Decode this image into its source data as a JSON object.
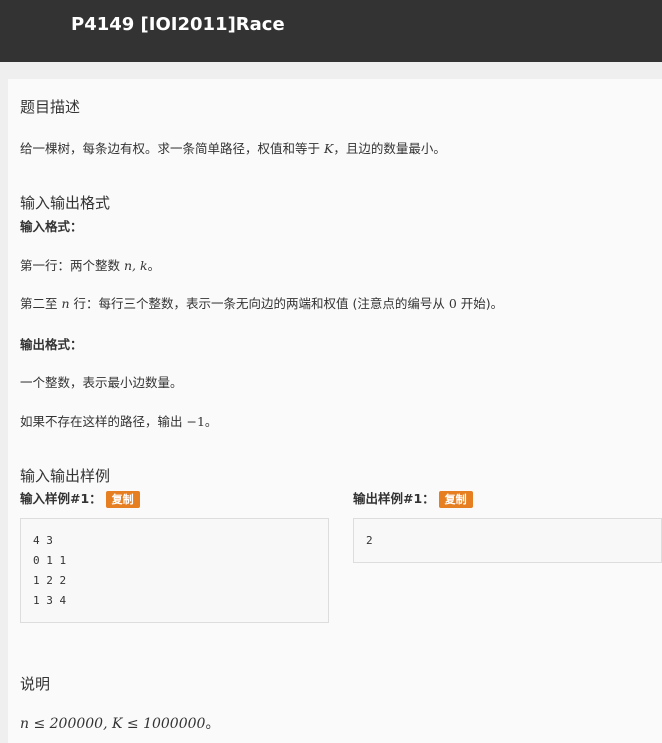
{
  "header": {
    "title": "P4149 [IOI2011]Race"
  },
  "description": {
    "heading": "题目描述",
    "text_prefix": "给一棵树，每条边有权。求一条简单路径，权值和等于 ",
    "text_var": "K",
    "text_suffix": "，且边的数量最小。"
  },
  "io_format": {
    "heading": "输入输出格式",
    "input_label": "输入格式：",
    "line1_prefix": "第一行：两个整数 ",
    "line1_var": "n, k",
    "line1_suffix": "。",
    "line2_prefix": "第二至 ",
    "line2_var": "n",
    "line2_middle": " 行：每行三个整数，表示一条无向边的两端和权值 (注意点的编号从 ",
    "line2_num": "0",
    "line2_suffix": " 开始)。",
    "output_label": "输出格式：",
    "output_line1": "一个整数，表示最小边数量。",
    "output_line2_prefix": "如果不存在这样的路径，输出 ",
    "output_line2_val": "−1",
    "output_line2_suffix": "。"
  },
  "samples": {
    "heading": "输入输出样例",
    "input_label": "输入样例#1：",
    "output_label": "输出样例#1：",
    "copy_label": "复制",
    "input_lines": [
      "4 3",
      "0 1 1",
      "1 2 2",
      "1 3 4"
    ],
    "output_lines": [
      "2"
    ]
  },
  "notes": {
    "heading": "说明",
    "text": "n ≤ 200000, K ≤ 1000000",
    "suffix": "。"
  }
}
